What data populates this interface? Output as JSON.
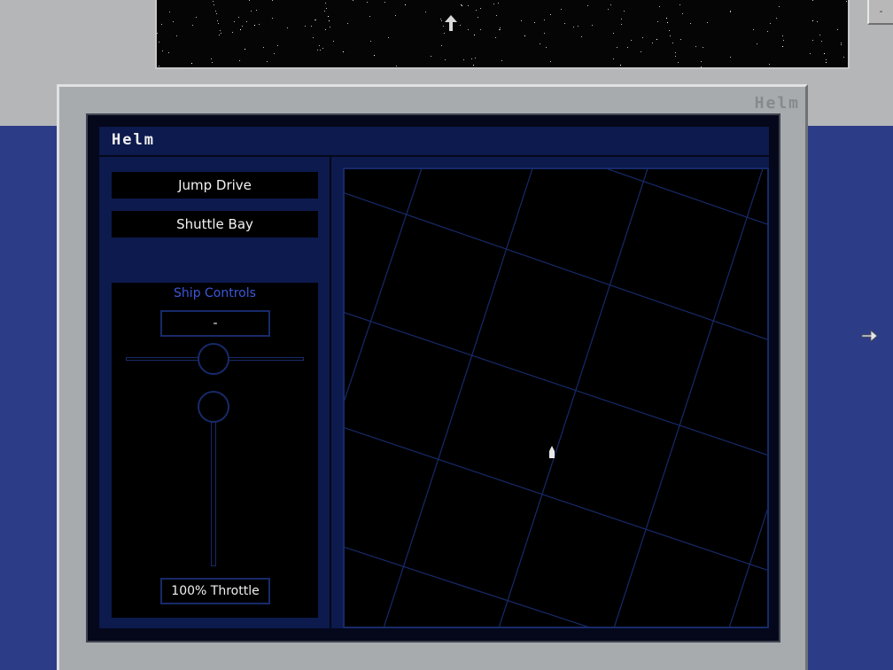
{
  "window": {
    "title": "Helm"
  },
  "helm": {
    "title": "Helm",
    "buttons": {
      "jump_drive": "Jump Drive",
      "shuttle_bay": "Shuttle Bay"
    },
    "ship_controls": {
      "title": "Ship Controls",
      "heading_value": "-",
      "throttle_label": "100% Throttle"
    }
  },
  "top_bar": {
    "minimize_label": "-"
  },
  "icons": {
    "up": "up-arrow-icon",
    "right": "right-arrow-icon",
    "ship": "ship-icon"
  },
  "colors": {
    "panel_dark": "#0d1a4d",
    "accent_text": "#3b57d8",
    "grid_line": "#172a6a",
    "background_blue": "#2d3c86"
  }
}
